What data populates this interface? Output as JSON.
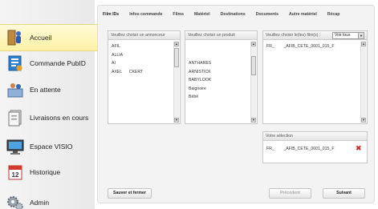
{
  "sidebar": {
    "items": [
      {
        "label": "Accueil",
        "icon": "person-at-door-icon",
        "active": true
      },
      {
        "label": "Commande PubID",
        "icon": "order-form-icon",
        "active": false
      },
      {
        "label": "En attente",
        "icon": "waiting-people-icon",
        "active": false
      },
      {
        "label": "Livraisons en cours",
        "icon": "document-stack-icon",
        "active": false
      },
      {
        "label": "Espace VISIO",
        "icon": "monitor-icon",
        "active": false
      },
      {
        "label": "Historique",
        "icon": "calendar-icon",
        "active": false
      },
      {
        "label": "Admin",
        "icon": "gears-icon",
        "active": false
      }
    ]
  },
  "tabs": [
    {
      "label": "Film IDs",
      "active": true
    },
    {
      "label": "Infos commande",
      "active": false
    },
    {
      "label": "Films",
      "active": false
    },
    {
      "label": "Matériel",
      "active": false
    },
    {
      "label": "Destinations",
      "active": false
    },
    {
      "label": "Documents",
      "active": false
    },
    {
      "label": "Autre matériel",
      "active": false
    },
    {
      "label": "Récap",
      "active": false
    }
  ],
  "advertiser_list": {
    "header": "Veuillez choisir un annonceur",
    "items": [
      "AFIL",
      "ALLIA",
      "AI",
      "AXEL      CKERT"
    ]
  },
  "product_list": {
    "header": "Veuillez choisir un produit",
    "items": [
      "ANTHARES",
      "ARNISTICK",
      "BABYLOOK",
      "Baignoire",
      "Bébé"
    ]
  },
  "film_list": {
    "header": "Veuillez choisir le(les) film(s) :",
    "filter_value": "Voir tous",
    "items": [
      "FR_        _AFIB_CETE_0001_015_F"
    ]
  },
  "selection": {
    "header": "Votre sélection",
    "items": [
      "FR_        _AFIB_CETE_0001_015_F"
    ]
  },
  "footer": {
    "save_label": "Sauver et fermer",
    "previous_label": "Précédent",
    "next_label": "Suivant"
  }
}
